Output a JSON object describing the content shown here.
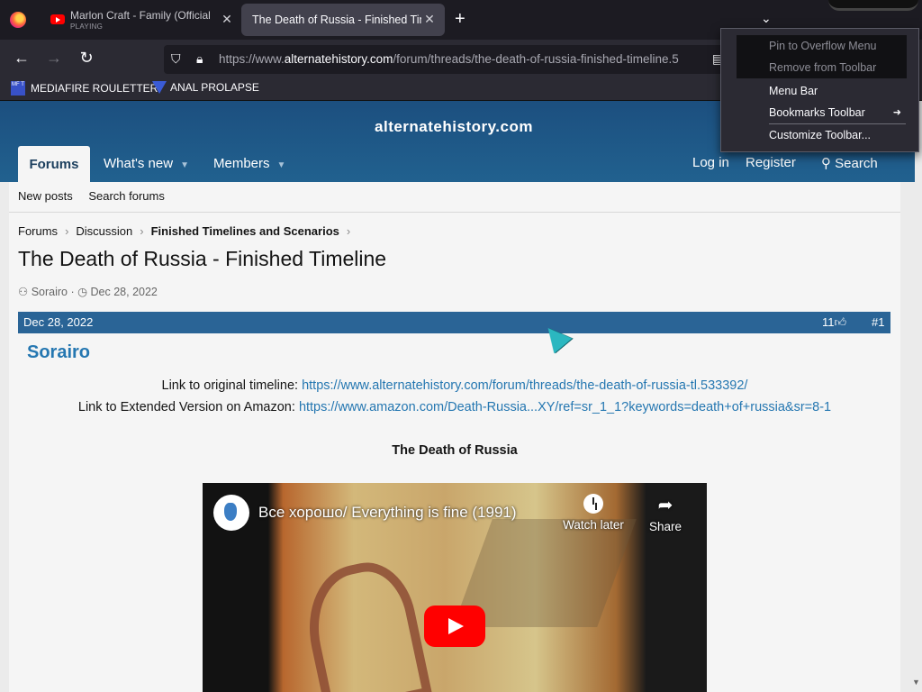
{
  "browser": {
    "tabs": [
      {
        "title": "Marlon Craft - Family (Official",
        "subtitle": "PLAYING",
        "close": "✕"
      },
      {
        "title": "The Death of Russia - Finished Time",
        "close": "✕"
      }
    ],
    "new_tab": "+",
    "tab_list": "⌄",
    "url_prefix": "https://www.",
    "url_domain": "alternatehistory.com",
    "url_rest": "/forum/threads/the-death-of-russia-finished-timeline.5",
    "bookmarks": [
      {
        "label": "MEDIAFIRE ROULETTER",
        "icon_text": "MF T"
      },
      {
        "label": "ANAL PROLAPSE"
      }
    ]
  },
  "context_menu": {
    "items": [
      {
        "label": "Pin to Overflow Menu",
        "key": "P",
        "disabled": true
      },
      {
        "label": "Remove from Toolbar",
        "key": "R",
        "disabled": true
      },
      {
        "label": "Menu Bar",
        "key": "M",
        "disabled": false
      },
      {
        "label": "Bookmarks Toolbar",
        "key": "B",
        "disabled": false,
        "submenu": true
      },
      {
        "label": "Customize Toolbar...",
        "key": "C",
        "disabled": false
      }
    ]
  },
  "site": {
    "title": "alternatehistory.com",
    "nav": {
      "forums": "Forums",
      "whats_new": "What's new",
      "members": "Members",
      "login": "Log in",
      "register": "Register",
      "search": "Search"
    },
    "subnav": {
      "new_posts": "New posts",
      "search_forums": "Search forums"
    },
    "breadcrumbs": [
      "Forums",
      "Discussion",
      "Finished Timelines and Scenarios"
    ],
    "thread_title": "The Death of Russia - Finished Timeline",
    "author": "Sorairo",
    "date": "Dec 28, 2022"
  },
  "post": {
    "date": "Dec 28, 2022",
    "likes": "11",
    "number": "#1",
    "author": "Sorairo",
    "line1_label": "Link to original timeline: ",
    "line1_link": "https://www.alternatehistory.com/forum/threads/the-death-of-russia-tl.533392/",
    "line2_label": "Link to Extended Version on Amazon: ",
    "line2_link": "https://www.amazon.com/Death-Russia...XY/ref=sr_1_1?keywords=death+of+russia&sr=8-1",
    "heading": "The Death of Russia"
  },
  "video": {
    "title": "Все хорошо/ Everything is fine (1991)",
    "watch_later": "Watch later",
    "share": "Share"
  },
  "colors": {
    "header_blue": "#1c4f7f",
    "post_bar": "#2a6496",
    "link": "#2577b1",
    "youtube_red": "#ff0000"
  }
}
